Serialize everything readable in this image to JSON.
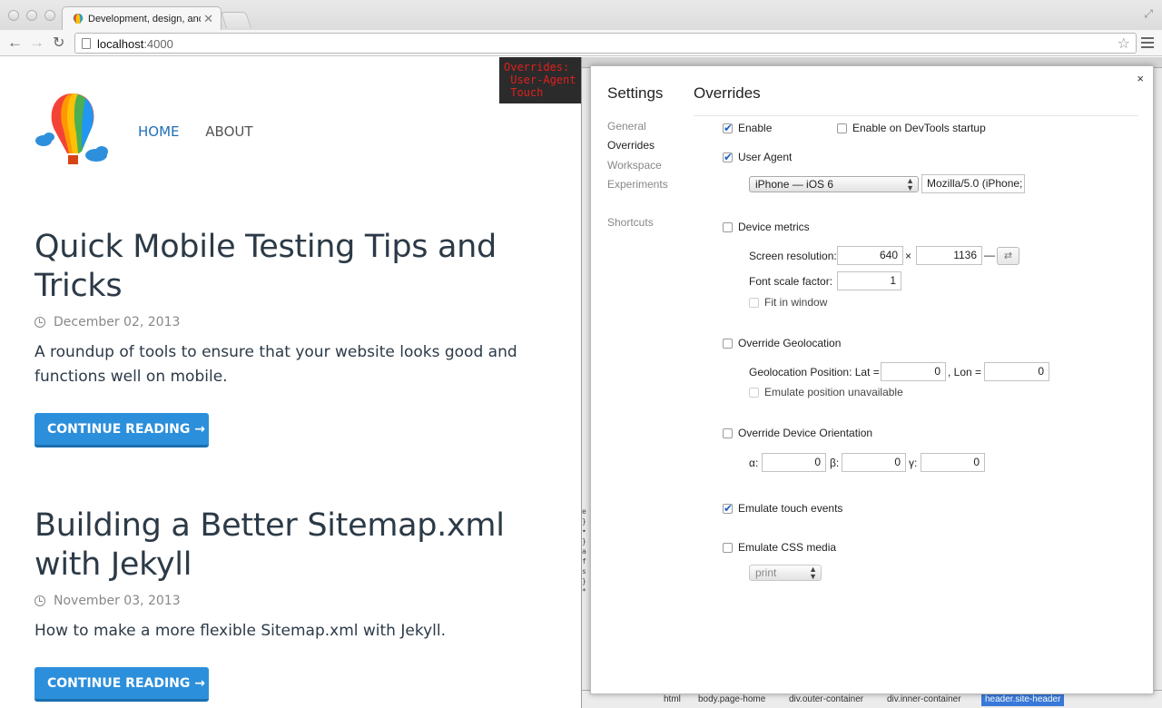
{
  "browser": {
    "tab_title": "Development, design, and",
    "tab_close": "✕",
    "url_host": "localhost",
    "url_port": ":4000"
  },
  "site": {
    "nav": {
      "home": "HOME",
      "about": "ABOUT"
    },
    "posts": [
      {
        "title": "Quick Mobile Testing Tips and Tricks",
        "date": "December 02, 2013",
        "excerpt": "A roundup of tools to ensure that your website looks good and functions well on mobile.",
        "button": "CONTINUE READING →"
      },
      {
        "title": "Building a Better Sitemap.xml with Jekyll",
        "date": "November 03, 2013",
        "excerpt": "How to make a more flexible Sitemap.xml with Jekyll.",
        "button": "CONTINUE READING →"
      }
    ]
  },
  "devtools": {
    "overrides_badge": "Overrides:\n User-Agent\n Touch",
    "breadcrumbs": [
      "html",
      "body.page-home",
      "div.outer-container",
      "div.inner-container",
      "header.site-header"
    ],
    "left_code": [
      "e",
      "}",
      "",
      "•",
      "",
      "}",
      "a",
      "f",
      "s",
      "",
      "}",
      "*"
    ],
    "settings": {
      "title": "Settings",
      "section": "Overrides",
      "close": "×",
      "sidebar": [
        "General",
        "Overrides",
        "Workspace",
        "Experiments",
        "Shortcuts"
      ],
      "enable": "Enable",
      "enable_on_startup": "Enable on DevTools startup",
      "user_agent": "User Agent",
      "ua_select": "iPhone — iOS 6",
      "ua_string": "Mozilla/5.0 (iPhone;",
      "device_metrics": "Device metrics",
      "screen_resolution_label": "Screen resolution:",
      "res_width": "640",
      "res_times": "×",
      "res_height": "1136",
      "res_dash": "—",
      "swap": "⇄",
      "font_scale_label": "Font scale factor:",
      "font_scale": "1",
      "fit_in_window": "Fit in window",
      "override_geolocation": "Override Geolocation",
      "geo_label": "Geolocation Position:  Lat =",
      "lat": "0",
      "lon_label": ", Lon =",
      "lon": "0",
      "emulate_position_unavailable": "Emulate position unavailable",
      "override_orientation": "Override Device Orientation",
      "alpha_label": "α:",
      "alpha": "0",
      "beta_label": "β:",
      "beta": "0",
      "gamma_label": "γ:",
      "gamma": "0",
      "emulate_touch": "Emulate touch events",
      "emulate_css_media": "Emulate CSS media",
      "css_media_select": "print"
    }
  }
}
